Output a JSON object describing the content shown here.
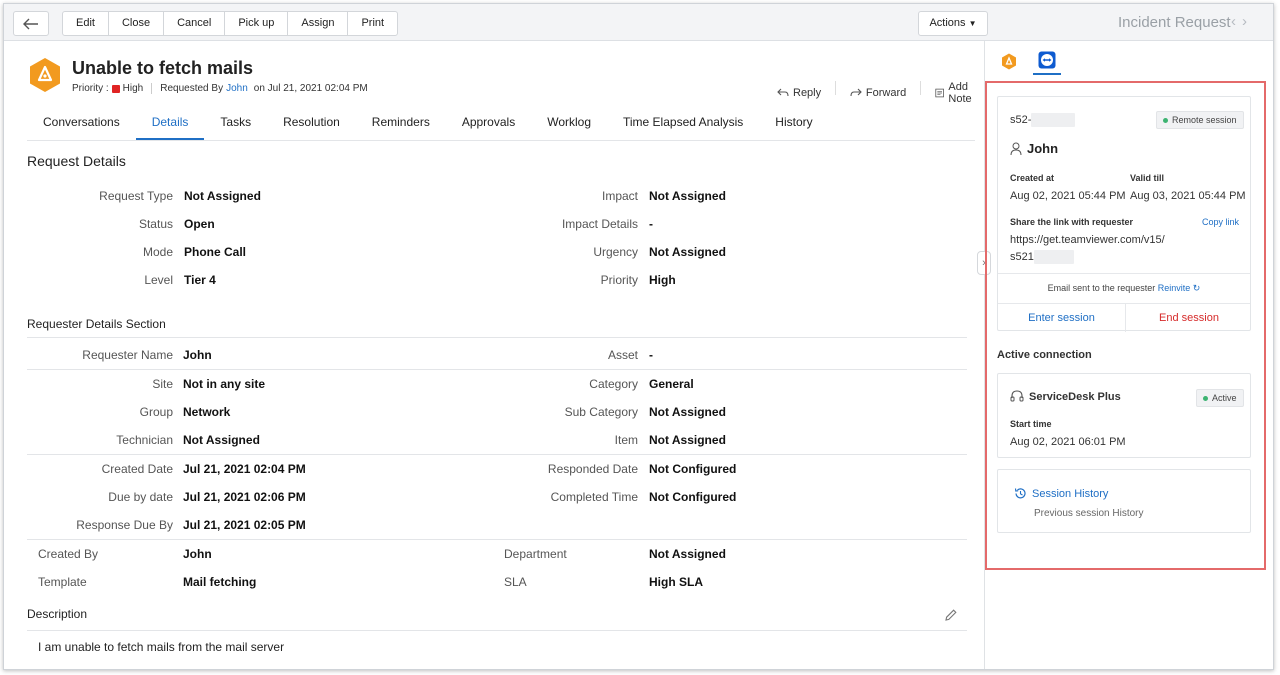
{
  "toolbar": {
    "buttons": [
      "Edit",
      "Close",
      "Cancel",
      "Pick up",
      "Assign",
      "Print"
    ],
    "actions_label": "Actions",
    "page_name": "Incident Request"
  },
  "request": {
    "title": "Unable to fetch mails",
    "priority_prefix": "Priority :",
    "priority": "High",
    "requested_by_prefix": "Requested By",
    "requester": "John",
    "requested_on": "on Jul 21, 2021 02:04 PM",
    "actions": {
      "reply": "Reply",
      "forward": "Forward",
      "add_note": "Add Note"
    }
  },
  "tabs": [
    "Conversations",
    "Details",
    "Tasks",
    "Resolution",
    "Reminders",
    "Approvals",
    "Worklog",
    "Time Elapsed Analysis",
    "History"
  ],
  "details": {
    "section_title": "Request Details",
    "left": [
      {
        "label": "Request Type",
        "value": "Not Assigned"
      },
      {
        "label": "Status",
        "value": "Open"
      },
      {
        "label": "Mode",
        "value": "Phone Call"
      },
      {
        "label": "Level",
        "value": "Tier 4"
      }
    ],
    "right": [
      {
        "label": "Impact",
        "value": "Not Assigned"
      },
      {
        "label": "Impact Details",
        "value": "-"
      },
      {
        "label": "Urgency",
        "value": "Not Assigned"
      },
      {
        "label": "Priority",
        "value": "High"
      }
    ]
  },
  "requester_section": {
    "title": "Requester Details Section",
    "rows": [
      {
        "l_label": "Requester Name",
        "l_value": "John",
        "r_label": "Asset",
        "r_value": "-"
      },
      {
        "l_label": "Site",
        "l_value": "Not in any site",
        "r_label": "Category",
        "r_value": "General"
      },
      {
        "l_label": "Group",
        "l_value": "Network",
        "r_label": "Sub Category",
        "r_value": "Not Assigned"
      },
      {
        "l_label": "Technician",
        "l_value": "Not Assigned",
        "r_label": "Item",
        "r_value": "Not Assigned"
      },
      {
        "l_label": "Created Date",
        "l_value": "Jul 21, 2021 02:04 PM",
        "r_label": "Responded Date",
        "r_value": "Not Configured"
      },
      {
        "l_label": "Due by date",
        "l_value": "Jul 21, 2021 02:06 PM",
        "r_label": "Completed Time",
        "r_value": "Not Configured"
      },
      {
        "l_label": "Response Due By",
        "l_value": "Jul 21, 2021 02:05 PM",
        "r_label": "",
        "r_value": ""
      }
    ],
    "extra_rows": [
      {
        "l_label": "Created By",
        "l_value": "John",
        "r_label": "Department",
        "r_value": "Not Assigned"
      },
      {
        "l_label": "Template",
        "l_value": "Mail fetching",
        "r_label": "SLA",
        "r_value": "High SLA"
      }
    ]
  },
  "description": {
    "title": "Description",
    "text": "I am unable to fetch mails from the mail server"
  },
  "remote": {
    "session_id_prefix": "s52-",
    "badge": "Remote session",
    "user": "John",
    "created_label": "Created at",
    "created_value": "Aug 02, 2021 05:44 PM",
    "valid_label": "Valid till",
    "valid_value": "Aug 03, 2021 05:44 PM",
    "share_label": "Share the link with requester",
    "copy_link": "Copy link",
    "link_line1": "https://get.teamviewer.com/v15/",
    "link_line2": "s521",
    "email_note": "Email sent to the requester",
    "reinvite": "Reinvite",
    "enter_session": "Enter session",
    "end_session": "End session"
  },
  "active_connection": {
    "title": "Active connection",
    "name": "ServiceDesk Plus",
    "status": "Active",
    "start_label": "Start time",
    "start_value": "Aug 02, 2021 06:01 PM"
  },
  "session_history": {
    "title": "Session History",
    "subtitle": "Previous session History"
  },
  "colors": {
    "accent": "#1f6fc5",
    "danger": "#e02424",
    "highlight": "#e46a6a",
    "active": "#3cb371"
  }
}
